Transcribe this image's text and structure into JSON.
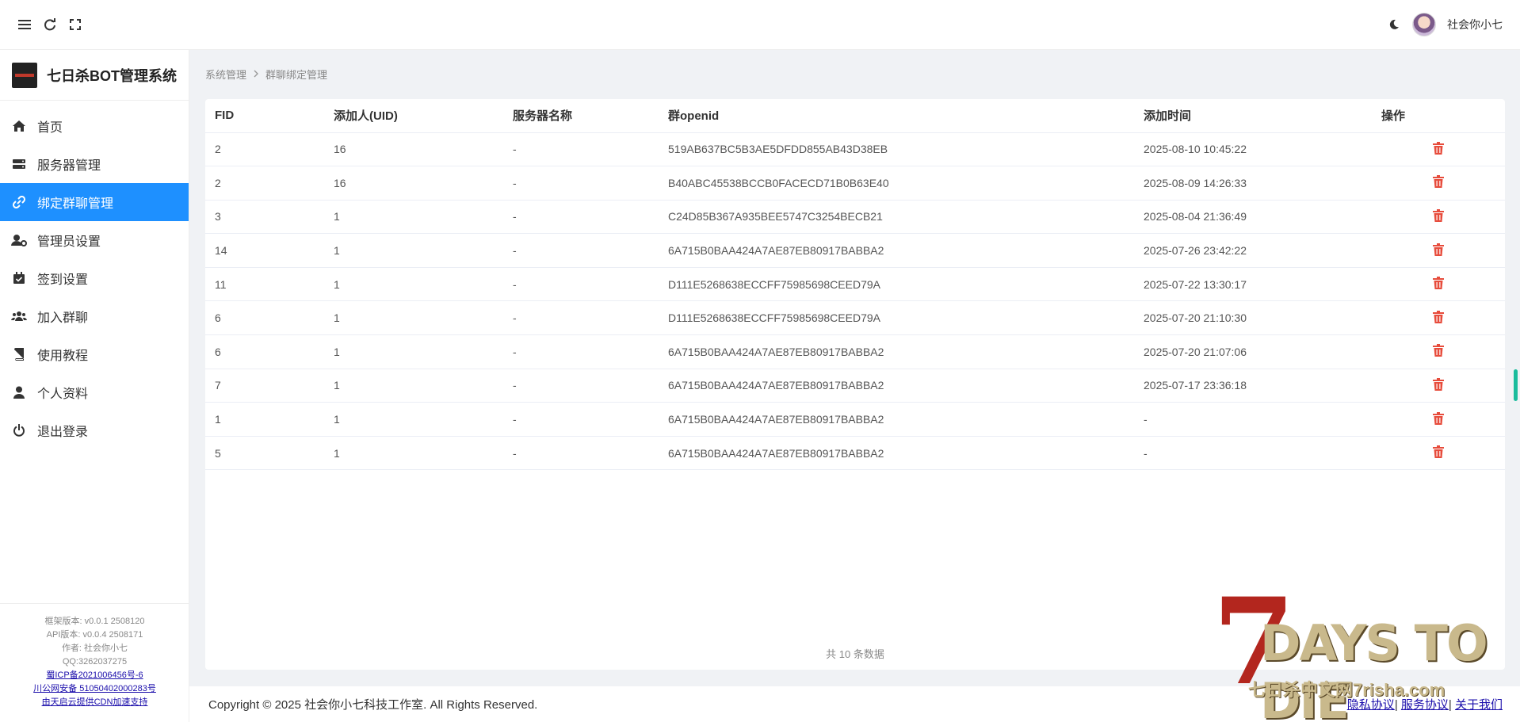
{
  "header": {
    "username": "社会你小七"
  },
  "sidebar": {
    "brand_title": "七日杀BOT管理系统",
    "items": [
      {
        "label": "首页",
        "icon": "home-icon"
      },
      {
        "label": "服务器管理",
        "icon": "server-icon"
      },
      {
        "label": "绑定群聊管理",
        "icon": "link-icon"
      },
      {
        "label": "管理员设置",
        "icon": "user-gear-icon"
      },
      {
        "label": "签到设置",
        "icon": "calendar-check-icon"
      },
      {
        "label": "加入群聊",
        "icon": "users-icon"
      },
      {
        "label": "使用教程",
        "icon": "book-icon"
      },
      {
        "label": "个人资料",
        "icon": "user-icon"
      },
      {
        "label": "退出登录",
        "icon": "power-icon"
      }
    ],
    "active_index": 2,
    "footer": {
      "framework_version": "框架版本: v0.0.1 2508120",
      "api_version": "API版本: v0.0.4 2508171",
      "author": "作者: 社会你小七",
      "qq": "QQ:3262037275",
      "icp": "蜀ICP备2021006456号-6",
      "police": "川公网安备 51050402000283号",
      "cdn": "由天启云提供CDN加速支持"
    }
  },
  "breadcrumb": {
    "root": "系统管理",
    "current": "群聊绑定管理"
  },
  "table": {
    "headers": [
      "FID",
      "添加人(UID)",
      "服务器名称",
      "群openid",
      "添加时间",
      "操作"
    ],
    "rows": [
      [
        "2",
        "16",
        "-",
        "519AB637BC5B3AE5DFDD855AB43D38EB",
        "2025-08-10 10:45:22"
      ],
      [
        "2",
        "16",
        "-",
        "B40ABC45538BCCB0FACECD71B0B63E40",
        "2025-08-09 14:26:33"
      ],
      [
        "3",
        "1",
        "-",
        "C24D85B367A935BEE5747C3254BECB21",
        "2025-08-04 21:36:49"
      ],
      [
        "14",
        "1",
        "-",
        "6A715B0BAA424A7AE87EB80917BABBA2",
        "2025-07-26 23:42:22"
      ],
      [
        "11",
        "1",
        "-",
        "D111E5268638ECCFF75985698CEED79A",
        "2025-07-22 13:30:17"
      ],
      [
        "6",
        "1",
        "-",
        "D111E5268638ECCFF75985698CEED79A",
        "2025-07-20 21:10:30"
      ],
      [
        "6",
        "1",
        "-",
        "6A715B0BAA424A7AE87EB80917BABBA2",
        "2025-07-20 21:07:06"
      ],
      [
        "7",
        "1",
        "-",
        "6A715B0BAA424A7AE87EB80917BABBA2",
        "2025-07-17 23:36:18"
      ],
      [
        "1",
        "1",
        "-",
        "6A715B0BAA424A7AE87EB80917BABBA2",
        "-"
      ],
      [
        "5",
        "1",
        "-",
        "6A715B0BAA424A7AE87EB80917BABBA2",
        "-"
      ]
    ],
    "total_text": "共 10 条数据"
  },
  "footer": {
    "copyright": "Copyright © 2025 社会你小七科技工作室. All Rights Reserved.",
    "links": [
      "隐私协议",
      "服务协议",
      "关于我们"
    ]
  },
  "watermark": {
    "logo_text": "7 DAYS TO DIE",
    "subtitle": "七日杀中文网7risha.com"
  },
  "colors": {
    "active": "#1e90ff",
    "danger": "#e74c3c"
  }
}
